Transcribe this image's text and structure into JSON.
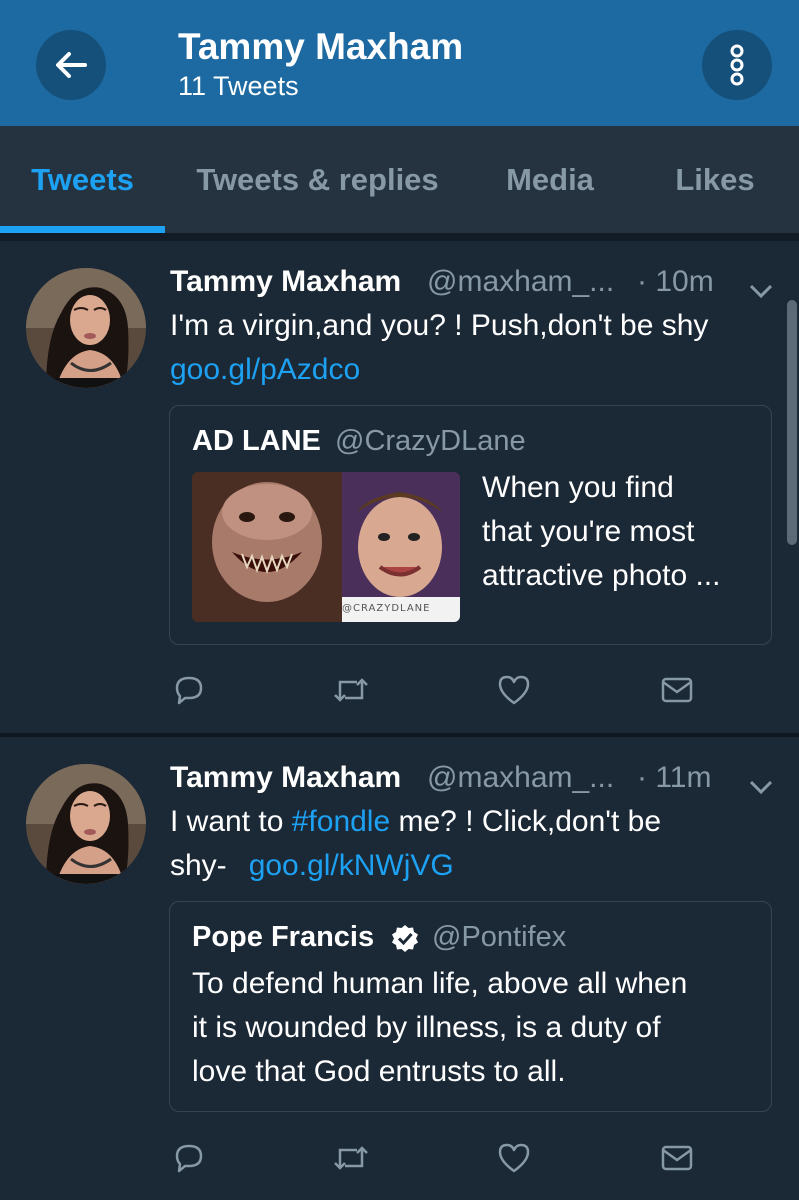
{
  "header": {
    "title": "Tammy Maxham",
    "subtitle": "11 Tweets",
    "back_icon": "arrow-left-icon",
    "more_icon": "more-vertical-icon"
  },
  "tabs": [
    {
      "label": "Tweets",
      "active": true
    },
    {
      "label": "Tweets & replies",
      "active": false
    },
    {
      "label": "Media",
      "active": false
    },
    {
      "label": "Likes",
      "active": false
    }
  ],
  "tweets": [
    {
      "name": "Tammy Maxham",
      "handle": "@maxham_...",
      "time": "· 10m",
      "text": "I'm a virgin,and you? !  Push,don't be shy",
      "link": "goo.gl/pAzdco",
      "quote": {
        "name": "AD LANE",
        "handle": "@CrazyDLane",
        "text_lines": [
          "When you find",
          "that you're most",
          "attractive photo ..."
        ],
        "media_watermark": "@CRAZYDLANE"
      }
    },
    {
      "name": "Tammy Maxham",
      "handle": "@maxham_...",
      "time": "· 11m",
      "text_pre": "I want to ",
      "hashtag": "#fondle",
      "text_post": " me? ! Click,don't be",
      "text_line2": "shy-",
      "link": "goo.gl/kNWjVG",
      "quote": {
        "name": "Pope Francis",
        "verified": true,
        "handle": "@Pontifex",
        "text_lines": [
          "To defend human life, above all when",
          "it is wounded by illness, is a duty of",
          "love that God entrusts to all."
        ]
      }
    }
  ],
  "colors": {
    "header_bg": "#1c6aa1",
    "page_bg": "#1b2836",
    "accent": "#1da1f2",
    "muted": "#8899a6"
  }
}
